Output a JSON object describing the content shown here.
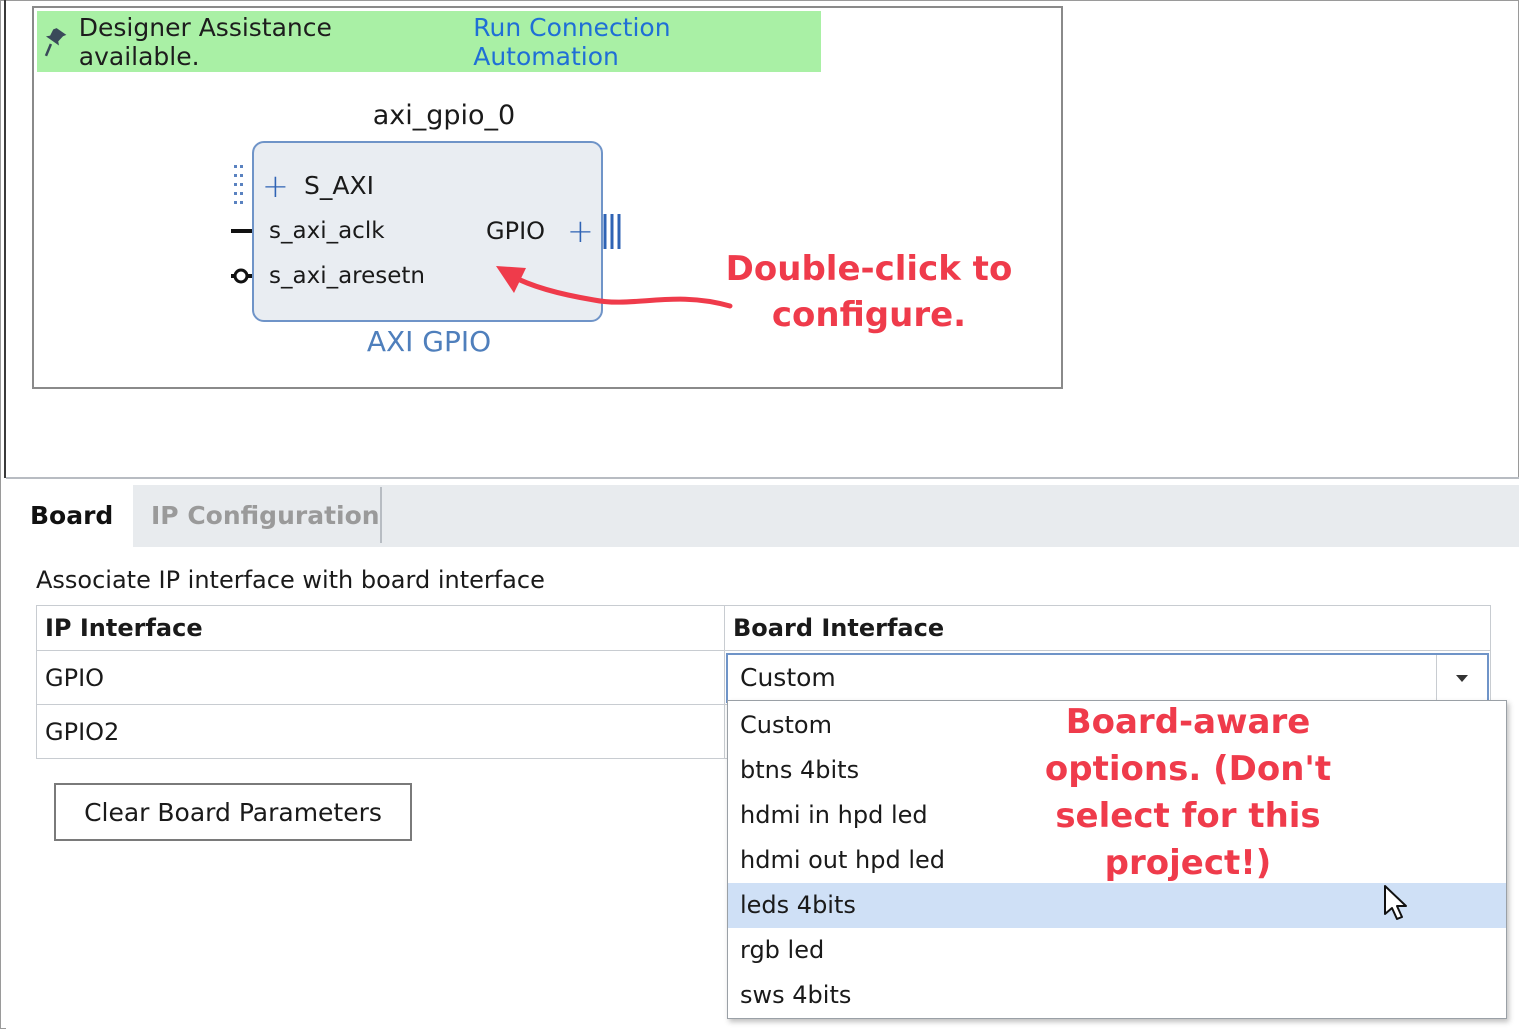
{
  "diagram": {
    "assistance_label": "Designer Assistance available.",
    "assistance_link": "Run Connection Automation",
    "block_name": "axi_gpio_0",
    "block_type": "AXI GPIO",
    "ports": {
      "s_axi": "S_AXI",
      "aclk": "s_axi_aclk",
      "aresetn": "s_axi_aresetn",
      "gpio": "GPIO"
    },
    "annotation": "Double-click to configure."
  },
  "panel": {
    "tabs": [
      "Board",
      "IP Configuration"
    ],
    "active_tab": "Board",
    "hint": "Associate IP interface with board interface",
    "table": {
      "headers": [
        "IP Interface",
        "Board Interface"
      ],
      "rows": [
        {
          "ip": "GPIO",
          "board": "Custom"
        },
        {
          "ip": "GPIO2",
          "board": ""
        }
      ]
    },
    "clear_button": "Clear Board Parameters",
    "dropdown": {
      "options": [
        "Custom",
        "btns 4bits",
        "hdmi in hpd led",
        "hdmi out hpd led",
        "leds 4bits",
        "rgb led",
        "sws 4bits"
      ],
      "highlighted": "leds 4bits"
    },
    "annotation": "Board-aware options. (Don't select for this project!)"
  },
  "colors": {
    "banner": "#a9f0a5",
    "link": "#1f6fd6",
    "block_border": "#6f94c8",
    "annotation": "#ef3b4b",
    "highlight": "#cfe0f6"
  }
}
